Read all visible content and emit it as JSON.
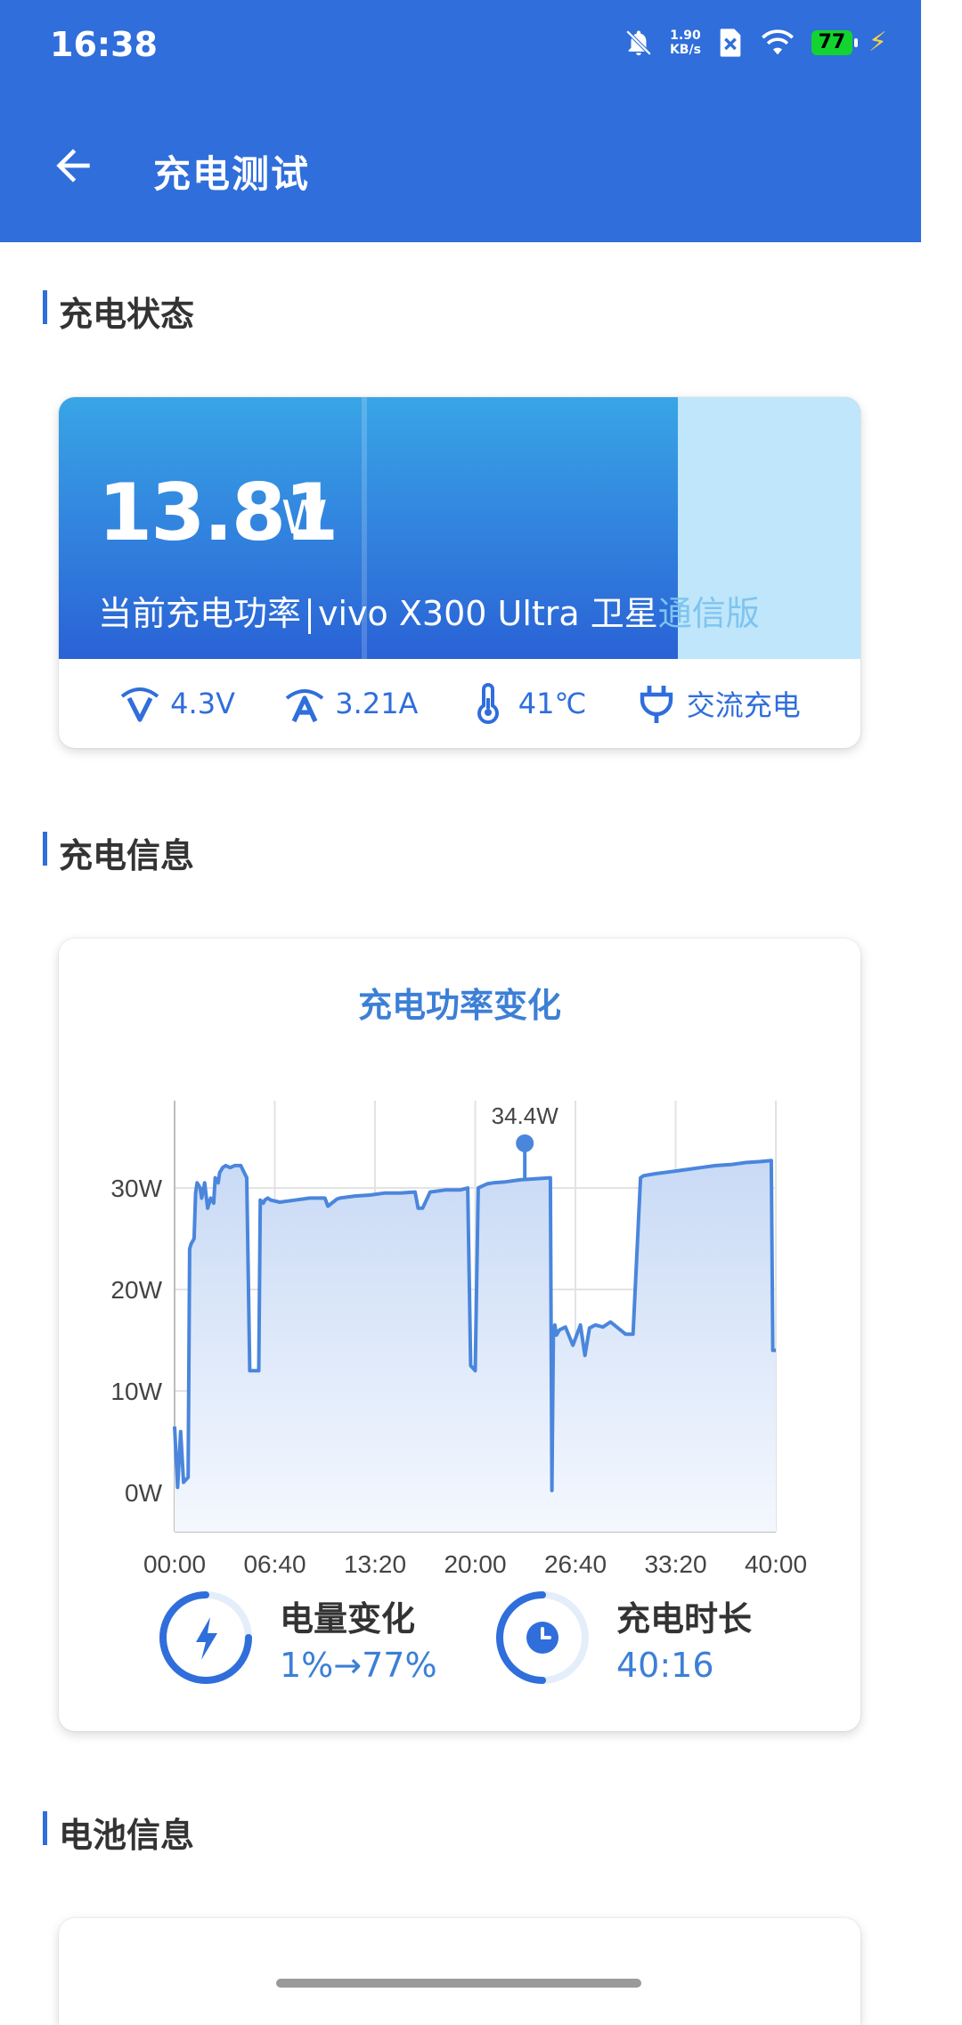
{
  "status_bar": {
    "time": "16:38",
    "net_speed_top": "1.90",
    "net_speed_bottom": "KB/s",
    "battery_level": "77",
    "icons": [
      "bell-off-icon",
      "sim-x-icon",
      "wifi-icon",
      "battery-icon",
      "charging-icon"
    ]
  },
  "header": {
    "title": "充电测试",
    "back_icon": "back-arrow-icon"
  },
  "sections": {
    "charge_status": "充电状态",
    "charge_info": "充电信息",
    "battery_info": "电池信息"
  },
  "status_card": {
    "power_value": "13.81",
    "power_unit": "W",
    "caption_prefix": "当前充电功率",
    "device_name": "vivo X300 Ultra 卫星",
    "device_suffix": "通信版",
    "voltage": "4.3V",
    "current": "3.21A",
    "temperature": "41℃",
    "charger_type": "交流充电"
  },
  "chart_card": {
    "title": "充电功率变化",
    "battery_change_label": "电量变化",
    "battery_change_value": "1%→77%",
    "duration_label": "充电时长",
    "duration_value": "40:16"
  },
  "chart_data": {
    "type": "area",
    "x_tick_labels": [
      "00:00",
      "06:40",
      "13:20",
      "20:00",
      "26:40",
      "33:20",
      "40:00"
    ],
    "y_tick_labels": [
      "0W",
      "10W",
      "20W",
      "30W"
    ],
    "ylim": [
      0,
      35
    ],
    "xlim": [
      0,
      40
    ],
    "max_point": {
      "x": 23.3,
      "y": 34.4,
      "label": "34.4W"
    },
    "series": [
      {
        "x": [
          0.0,
          0.2,
          0.4,
          0.6,
          0.9,
          1.0,
          1.1,
          1.3,
          1.4,
          1.5,
          1.7,
          1.8,
          2.0,
          2.2,
          2.4,
          2.6,
          2.7,
          2.9,
          3.0,
          3.2,
          3.4,
          3.7,
          4.0,
          4.4,
          4.8,
          5.0,
          5.6,
          5.7,
          5.9,
          6.0,
          6.2,
          6.4,
          7.0,
          8.0,
          9.0,
          10.0,
          10.2,
          10.8,
          11.0,
          12.0,
          13.0,
          14.0,
          15.0,
          16.0,
          16.2,
          16.5,
          17.0,
          18.0,
          19.0,
          19.5,
          19.7,
          20.0,
          20.2,
          20.5,
          20.8,
          21.2,
          22.0,
          23.0,
          24.0,
          25.0,
          25.1,
          25.2,
          25.3,
          25.4,
          25.6,
          26.0,
          26.5,
          27.0,
          27.3,
          27.6,
          28.0,
          28.5,
          29.0,
          30.0,
          30.5,
          31.0,
          31.2,
          32.0,
          33.0,
          34.0,
          35.0,
          36.0,
          37.0,
          38.0,
          39.0,
          39.7,
          39.8,
          40.0
        ],
        "y": [
          6.5,
          0.5,
          6.0,
          1.0,
          1.5,
          24.0,
          24.5,
          25.0,
          29.5,
          30.5,
          30.0,
          29.0,
          30.5,
          28.0,
          29.0,
          28.5,
          31.0,
          30.5,
          31.5,
          32.0,
          32.2,
          32.0,
          32.2,
          32.2,
          31.0,
          12.0,
          12.0,
          28.8,
          28.5,
          28.8,
          29.0,
          28.8,
          28.6,
          28.8,
          29.0,
          29.0,
          28.2,
          28.9,
          29.0,
          29.2,
          29.3,
          29.5,
          29.5,
          29.6,
          28.0,
          28.0,
          29.6,
          29.8,
          29.8,
          30.0,
          12.5,
          12.0,
          30.0,
          30.2,
          30.4,
          30.5,
          30.6,
          30.8,
          30.9,
          31.0,
          0.2,
          16.0,
          16.5,
          15.5,
          16.0,
          16.3,
          14.5,
          16.5,
          13.5,
          16.2,
          16.5,
          16.3,
          16.8,
          15.6,
          15.6,
          31.0,
          31.2,
          31.4,
          31.6,
          31.8,
          32.0,
          32.2,
          32.3,
          32.5,
          32.6,
          32.7,
          14.0,
          14.0
        ]
      }
    ]
  }
}
